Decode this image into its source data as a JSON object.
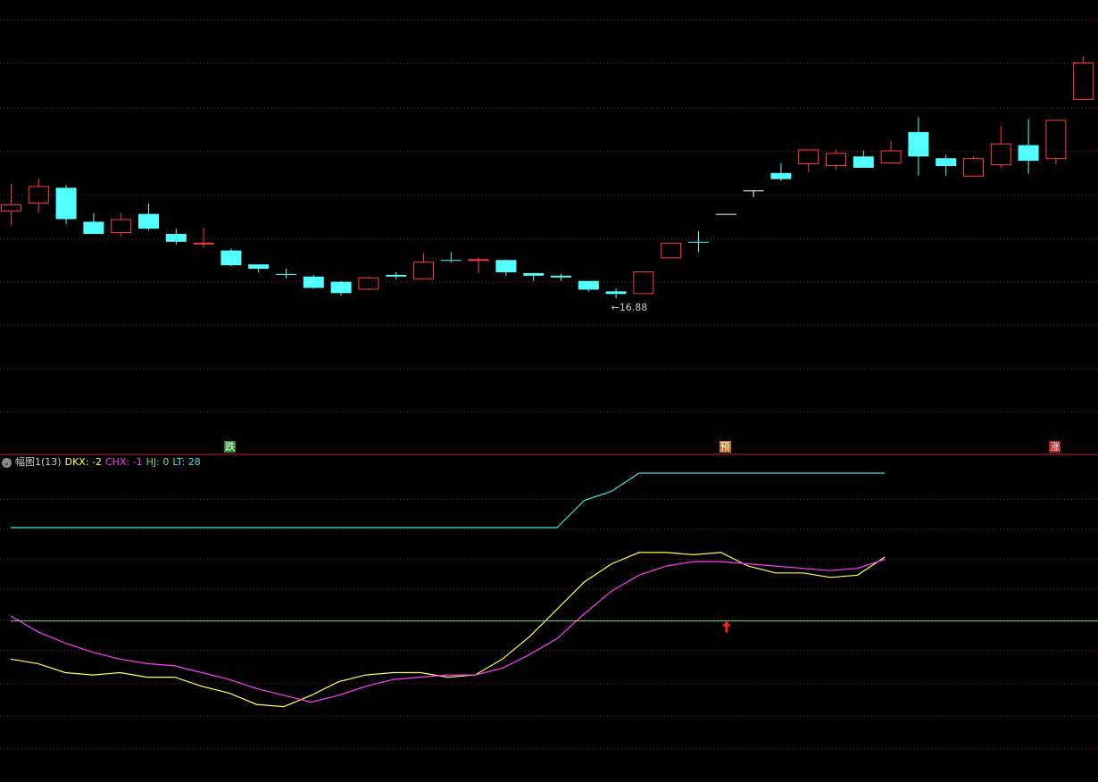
{
  "colors": {
    "background": "#000000",
    "grid": "#7a1a1a",
    "divider": "#c02828",
    "up": "#ff3c3c",
    "down": "#54ffff",
    "flat": "#ffffff",
    "price_annotation": "#c8c8c8",
    "dkx": "#ffff50",
    "chx": "#ff3cff",
    "hj": "#7ed87e",
    "lt": "#40e0e8"
  },
  "price_annotation": {
    "text": "16.88",
    "icon": "arrow-left-icon"
  },
  "signals": [
    {
      "text": "跌",
      "color": "#2e8b2e",
      "bar": 8
    },
    {
      "text": "预",
      "color": "#c87020",
      "bar": 26
    },
    {
      "text": "涨",
      "color": "#b02020",
      "bar": 38
    }
  ],
  "indicator": {
    "name": "幅图1(13)",
    "dkx_label": "DKX: -2",
    "chx_label": "CHX: -1",
    "hj_label": "HJ: 0",
    "lt_label": "LT: 28",
    "collapse_icon": "chevron-down-icon"
  },
  "chart_data": [
    {
      "type": "candlestick",
      "title": "",
      "min_price_label": 16.88,
      "candles": [
        {
          "o": 22.8,
          "c": 23.6,
          "h": 25.9,
          "l": 21.2,
          "dir": "up"
        },
        {
          "o": 23.7,
          "c": 25.7,
          "h": 26.6,
          "l": 22.6,
          "dir": "up"
        },
        {
          "o": 25.5,
          "c": 21.9,
          "h": 25.8,
          "l": 21.3,
          "dir": "down"
        },
        {
          "o": 21.6,
          "c": 20.2,
          "h": 22.6,
          "l": 20.2,
          "dir": "down"
        },
        {
          "o": 20.3,
          "c": 21.9,
          "h": 22.6,
          "l": 19.9,
          "dir": "up"
        },
        {
          "o": 22.5,
          "c": 20.8,
          "h": 23.7,
          "l": 20.6,
          "dir": "down"
        },
        {
          "o": 20.2,
          "c": 19.3,
          "h": 20.8,
          "l": 19.0,
          "dir": "down"
        },
        {
          "o": 19.2,
          "c": 19.2,
          "h": 20.9,
          "l": 18.6,
          "dir": "up"
        },
        {
          "o": 18.3,
          "c": 16.6,
          "h": 18.5,
          "l": 16.5,
          "dir": "down"
        },
        {
          "o": 16.7,
          "c": 16.2,
          "h": 16.7,
          "l": 15.8,
          "dir": "down"
        },
        {
          "o": 15.6,
          "c": 15.6,
          "h": 16.2,
          "l": 15.1,
          "dir": "down"
        },
        {
          "o": 15.3,
          "c": 14.0,
          "h": 15.5,
          "l": 13.9,
          "dir": "down"
        },
        {
          "o": 14.7,
          "c": 13.4,
          "h": 14.8,
          "l": 13.1,
          "dir": "down"
        },
        {
          "o": 13.8,
          "c": 15.2,
          "h": 15.3,
          "l": 13.7,
          "dir": "up"
        },
        {
          "o": 15.5,
          "c": 15.3,
          "h": 15.8,
          "l": 15.0,
          "dir": "down"
        },
        {
          "o": 15.0,
          "c": 17.0,
          "h": 18.0,
          "l": 15.0,
          "dir": "up"
        },
        {
          "o": 17.2,
          "c": 17.1,
          "h": 18.1,
          "l": 16.9,
          "dir": "down"
        },
        {
          "o": 17.3,
          "c": 17.3,
          "h": 17.5,
          "l": 15.7,
          "dir": "up"
        },
        {
          "o": 17.2,
          "c": 15.8,
          "h": 17.3,
          "l": 15.4,
          "dir": "down"
        },
        {
          "o": 15.7,
          "c": 15.4,
          "h": 15.7,
          "l": 14.8,
          "dir": "down"
        },
        {
          "o": 15.4,
          "c": 15.2,
          "h": 15.6,
          "l": 14.8,
          "dir": "down"
        },
        {
          "o": 14.8,
          "c": 13.8,
          "h": 14.8,
          "l": 13.6,
          "dir": "down"
        },
        {
          "o": 13.6,
          "c": 13.3,
          "h": 13.9,
          "l": 12.8,
          "dir": "down"
        },
        {
          "o": 13.3,
          "c": 15.9,
          "h": 15.9,
          "l": 13.3,
          "dir": "up"
        },
        {
          "o": 17.4,
          "c": 19.2,
          "h": 19.2,
          "l": 17.4,
          "dir": "up"
        },
        {
          "o": 19.3,
          "c": 19.3,
          "h": 20.5,
          "l": 18.1,
          "dir": "down"
        },
        {
          "o": 22.5,
          "c": 22.5,
          "h": 22.5,
          "l": 22.5,
          "dir": "flat"
        },
        {
          "o": 25.2,
          "c": 25.2,
          "h": 25.2,
          "l": 24.4,
          "dir": "flat"
        },
        {
          "o": 27.2,
          "c": 26.5,
          "h": 28.3,
          "l": 26.3,
          "dir": "down"
        },
        {
          "o": 28.2,
          "c": 29.9,
          "h": 29.9,
          "l": 27.3,
          "dir": "up"
        },
        {
          "o": 28.0,
          "c": 29.5,
          "h": 29.9,
          "l": 27.6,
          "dir": "up"
        },
        {
          "o": 29.1,
          "c": 27.8,
          "h": 29.8,
          "l": 27.8,
          "dir": "down"
        },
        {
          "o": 28.3,
          "c": 29.8,
          "h": 30.9,
          "l": 28.3,
          "dir": "up"
        },
        {
          "o": 31.9,
          "c": 29.1,
          "h": 33.6,
          "l": 26.9,
          "dir": "down"
        },
        {
          "o": 28.9,
          "c": 28.0,
          "h": 29.3,
          "l": 26.9,
          "dir": "down"
        },
        {
          "o": 26.8,
          "c": 28.9,
          "h": 29.1,
          "l": 26.8,
          "dir": "up"
        },
        {
          "o": 28.1,
          "c": 30.6,
          "h": 32.6,
          "l": 27.8,
          "dir": "up"
        },
        {
          "o": 30.4,
          "c": 28.6,
          "h": 33.4,
          "l": 27.1,
          "dir": "down"
        },
        {
          "o": 28.8,
          "c": 33.3,
          "h": 33.3,
          "l": 28.2,
          "dir": "up"
        },
        {
          "o": 35.6,
          "c": 39.9,
          "h": 40.6,
          "l": 35.6,
          "dir": "up"
        }
      ]
    },
    {
      "type": "line",
      "title": "幅图1(13)",
      "ylim": [
        -4,
        100
      ],
      "series": [
        {
          "name": "DKX",
          "color": "#ffff50",
          "values": [
            18,
            16,
            12,
            11,
            12,
            10,
            10,
            6,
            3,
            -2,
            -3,
            2,
            8,
            11,
            12,
            12,
            10,
            11,
            18,
            28,
            40,
            52,
            60,
            65,
            65,
            64,
            65,
            59,
            56,
            56,
            54,
            55,
            63
          ]
        },
        {
          "name": "CHX",
          "color": "#ff3cff",
          "values": [
            37,
            30,
            25,
            21,
            18,
            16,
            15,
            12,
            9,
            5,
            2,
            -1,
            2,
            6,
            9,
            10,
            11,
            11,
            14,
            20,
            27,
            38,
            48,
            55,
            59,
            61,
            61,
            60,
            59,
            58,
            57,
            58,
            62
          ]
        },
        {
          "name": "HJ",
          "color": "#7ed87e",
          "values": [
            35
          ]
        },
        {
          "name": "LT",
          "color": "#40e0e8",
          "values": [
            76,
            76,
            76,
            76,
            76,
            76,
            76,
            76,
            76,
            76,
            76,
            76,
            76,
            76,
            76,
            76,
            76,
            76,
            76,
            76,
            76,
            88,
            92,
            100,
            100,
            100,
            100,
            100,
            100,
            100,
            100,
            100,
            100
          ]
        }
      ]
    }
  ]
}
